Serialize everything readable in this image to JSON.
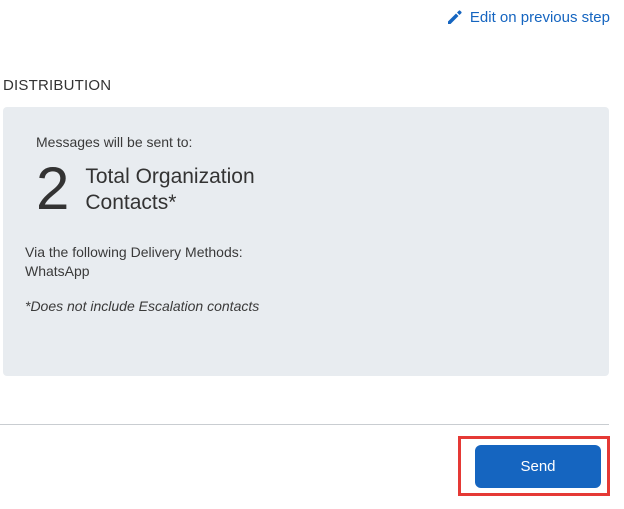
{
  "header": {
    "edit_link_label": "Edit on previous step",
    "edit_icon": "pencil-icon"
  },
  "distribution": {
    "heading": "DISTRIBUTION",
    "intro": "Messages will be sent to:",
    "count": "2",
    "count_label_line1": "Total Organization",
    "count_label_line2": "Contacts*",
    "delivery_intro": "Via the following Delivery Methods:",
    "delivery_method": "WhatsApp",
    "footnote": "*Does not include Escalation contacts"
  },
  "footer": {
    "send_label": "Send"
  },
  "colors": {
    "accent": "#1565c0",
    "card_background": "#e8ecf0",
    "highlight": "#e53935"
  }
}
